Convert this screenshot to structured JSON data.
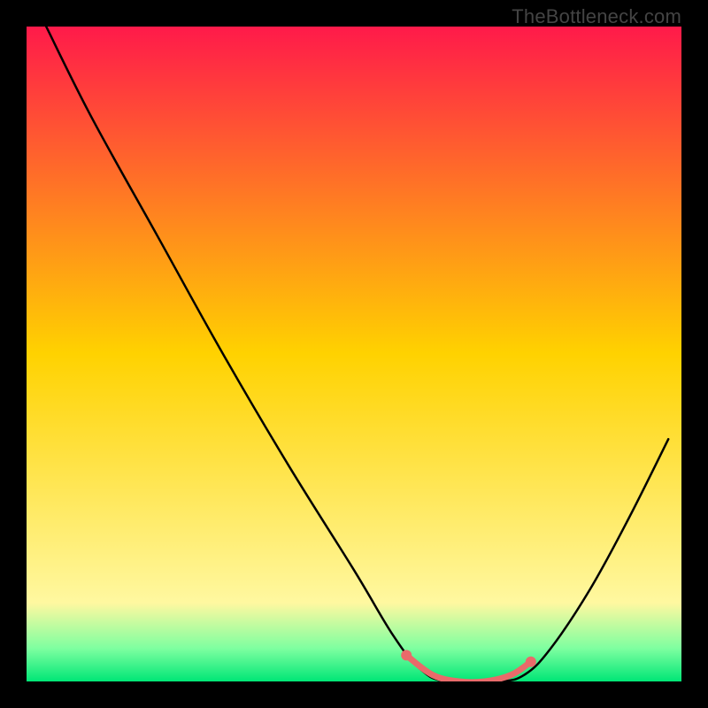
{
  "watermark": "TheBottleneck.com",
  "chart_data": {
    "type": "line",
    "title": "",
    "xlabel": "",
    "ylabel": "",
    "xlim": [
      0,
      100
    ],
    "ylim": [
      0,
      100
    ],
    "grid": false,
    "background_gradient": {
      "stops": [
        {
          "offset": 0,
          "color": "#ff1a4a"
        },
        {
          "offset": 50,
          "color": "#ffd200"
        },
        {
          "offset": 88,
          "color": "#fff8a0"
        },
        {
          "offset": 95,
          "color": "#7dffa0"
        },
        {
          "offset": 100,
          "color": "#00e676"
        }
      ]
    },
    "series": [
      {
        "name": "bottleneck-curve",
        "stroke": "#000000",
        "points": [
          {
            "x": 3,
            "y": 100
          },
          {
            "x": 10,
            "y": 86
          },
          {
            "x": 20,
            "y": 68
          },
          {
            "x": 30,
            "y": 50
          },
          {
            "x": 40,
            "y": 33
          },
          {
            "x": 50,
            "y": 17
          },
          {
            "x": 56,
            "y": 7
          },
          {
            "x": 60,
            "y": 2
          },
          {
            "x": 64,
            "y": 0
          },
          {
            "x": 72,
            "y": 0
          },
          {
            "x": 76,
            "y": 1
          },
          {
            "x": 80,
            "y": 5
          },
          {
            "x": 86,
            "y": 14
          },
          {
            "x": 92,
            "y": 25
          },
          {
            "x": 98,
            "y": 37
          }
        ]
      },
      {
        "name": "highlight-segment",
        "stroke": "#e96a6a",
        "points": [
          {
            "x": 58,
            "y": 4
          },
          {
            "x": 62,
            "y": 1
          },
          {
            "x": 66,
            "y": 0
          },
          {
            "x": 70,
            "y": 0
          },
          {
            "x": 74,
            "y": 1
          },
          {
            "x": 77,
            "y": 3
          }
        ]
      }
    ],
    "marker_dots": [
      {
        "x": 58,
        "y": 4,
        "color": "#e96a6a"
      },
      {
        "x": 77,
        "y": 3,
        "color": "#e96a6a"
      }
    ]
  }
}
